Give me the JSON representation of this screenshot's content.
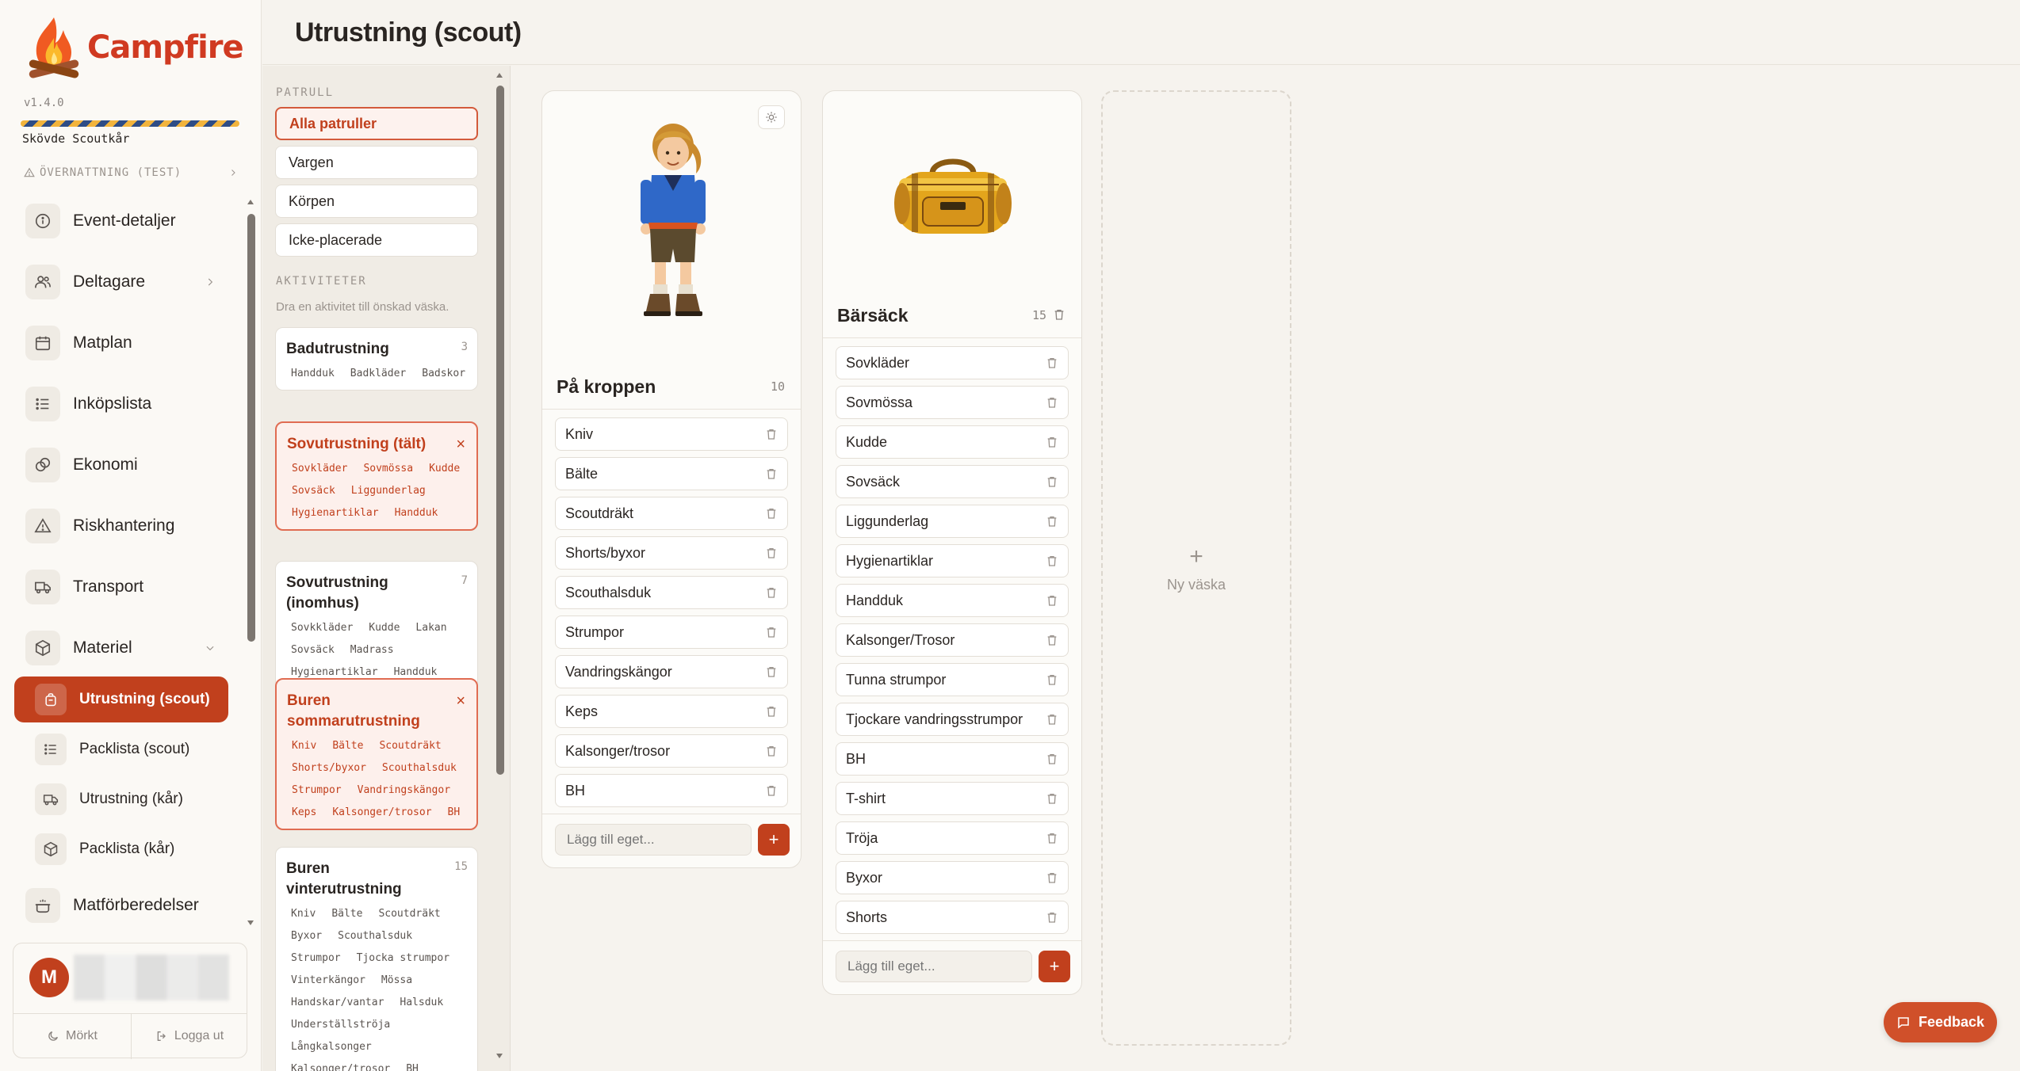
{
  "app": {
    "name": "Campfire",
    "version": "v1.4.0",
    "organization": "Skövde Scoutkår",
    "event_label": "ÖVERNATTNING (TEST)"
  },
  "nav": {
    "items": [
      {
        "label": "Event-detaljer",
        "icon": "info-icon"
      },
      {
        "label": "Deltagare",
        "icon": "users-icon"
      },
      {
        "label": "Matplan",
        "icon": "calendar-icon"
      },
      {
        "label": "Inköpslista",
        "icon": "list-icon"
      },
      {
        "label": "Ekonomi",
        "icon": "coins-icon"
      },
      {
        "label": "Riskhantering",
        "icon": "warning-icon"
      },
      {
        "label": "Transport",
        "icon": "truck-icon"
      },
      {
        "label": "Materiel",
        "icon": "box-icon"
      }
    ],
    "sub_items": [
      {
        "label": "Utrustning (scout)",
        "icon": "backpack-icon",
        "active": true
      },
      {
        "label": "Packlista (scout)",
        "icon": "list-icon"
      },
      {
        "label": "Utrustning (kår)",
        "icon": "truck-icon"
      },
      {
        "label": "Packlista (kår)",
        "icon": "box-icon"
      }
    ],
    "after": {
      "label": "Matförberedelser",
      "icon": "cooking-pot-icon"
    }
  },
  "user": {
    "initial": "M",
    "dark_label": "Mörkt",
    "logout_label": "Logga ut"
  },
  "page": {
    "title": "Utrustning (scout)"
  },
  "filters": {
    "patrol_heading": "PATRULL",
    "patrols": [
      "Alla patruller",
      "Vargen",
      "Körpen",
      "Icke-placerade"
    ],
    "active_patrol": "Alla patruller",
    "activities_heading": "AKTIVITETER",
    "hint": "Dra en aktivitet till önskad väska.",
    "activities": [
      {
        "title": "Badutrustning",
        "count": "3",
        "selected": false,
        "tags": [
          "Handduk",
          "Badkläder",
          "Badskor"
        ]
      },
      {
        "title": "Sovutrustning (tält)",
        "count": "",
        "selected": true,
        "tags": [
          "Sovkläder",
          "Sovmössa",
          "Kudde",
          "Sovsäck",
          "Liggunderlag",
          "Hygienartiklar",
          "Handduk"
        ]
      },
      {
        "title": "Sovutrustning (inomhus)",
        "count": "7",
        "selected": false,
        "tags": [
          "Sovkkläder",
          "Kudde",
          "Lakan",
          "Sovsäck",
          "Madrass",
          "Hygienartiklar",
          "Handduk"
        ]
      },
      {
        "title": "Buren sommarutrustning",
        "count": "",
        "selected": true,
        "tags": [
          "Kniv",
          "Bälte",
          "Scoutdräkt",
          "Shorts/byxor",
          "Scouthalsduk",
          "Strumpor",
          "Vandringskängor",
          "Keps",
          "Kalsonger/trosor",
          "BH"
        ]
      },
      {
        "title": "Buren vinterutrustning",
        "count": "15",
        "selected": false,
        "tags": [
          "Kniv",
          "Bälte",
          "Scoutdräkt",
          "Byxor",
          "Scouthalsduk",
          "Strumpor",
          "Tjocka strumpor",
          "Vinterkängor",
          "Mössa",
          "Handskar/vantar",
          "Halsduk",
          "Underställströja",
          "Långkalsonger",
          "Kalsonger/trosor",
          "BH"
        ]
      }
    ]
  },
  "bags": [
    {
      "title": "På kroppen",
      "count": "10",
      "image": "scout-figure",
      "items": [
        "Kniv",
        "Bälte",
        "Scoutdräkt",
        "Shorts/byxor",
        "Scouthalsduk",
        "Strumpor",
        "Vandringskängor",
        "Keps",
        "Kalsonger/trosor",
        "BH"
      ],
      "add_placeholder": "Lägg till eget..."
    },
    {
      "title": "Bärsäck",
      "count": "15",
      "image": "duffel-bag",
      "items": [
        "Sovkläder",
        "Sovmössa",
        "Kudde",
        "Sovsäck",
        "Liggunderlag",
        "Hygienartiklar",
        "Handduk",
        "Kalsonger/Trosor",
        "Tunna strumpor",
        "Tjockare vandringsstrumpor",
        "BH",
        "T-shirt",
        "Tröja",
        "Byxor",
        "Shorts"
      ],
      "add_placeholder": "Lägg till eget..."
    }
  ],
  "new_bag_label": "Ny väska",
  "feedback_label": "Feedback",
  "colors": {
    "accent": "#c1401d",
    "brand": "#d03a21",
    "background": "#f6f3ee"
  }
}
